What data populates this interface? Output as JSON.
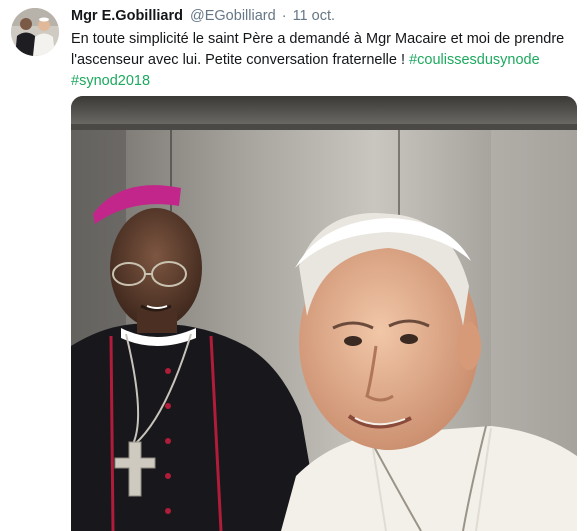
{
  "tweet": {
    "author_name": "Mgr E.Gobilliard",
    "handle": "@EGobilliard",
    "separator": "·",
    "timestamp": "11 oct.",
    "text": "En toute simplicité le saint Père a demandé à Mgr Macaire et moi de prendre l'ascenseur avec lui. Petite conversation fraternelle ! ",
    "hashtags": [
      "#coulissesdusynode",
      "#synod2018"
    ],
    "icons": {
      "avatar": "profile-photo",
      "photo": "elevator-selfie-photo"
    },
    "colors": {
      "hashtag": "#1da95f",
      "name": "#14171a",
      "secondary": "#657786"
    }
  }
}
